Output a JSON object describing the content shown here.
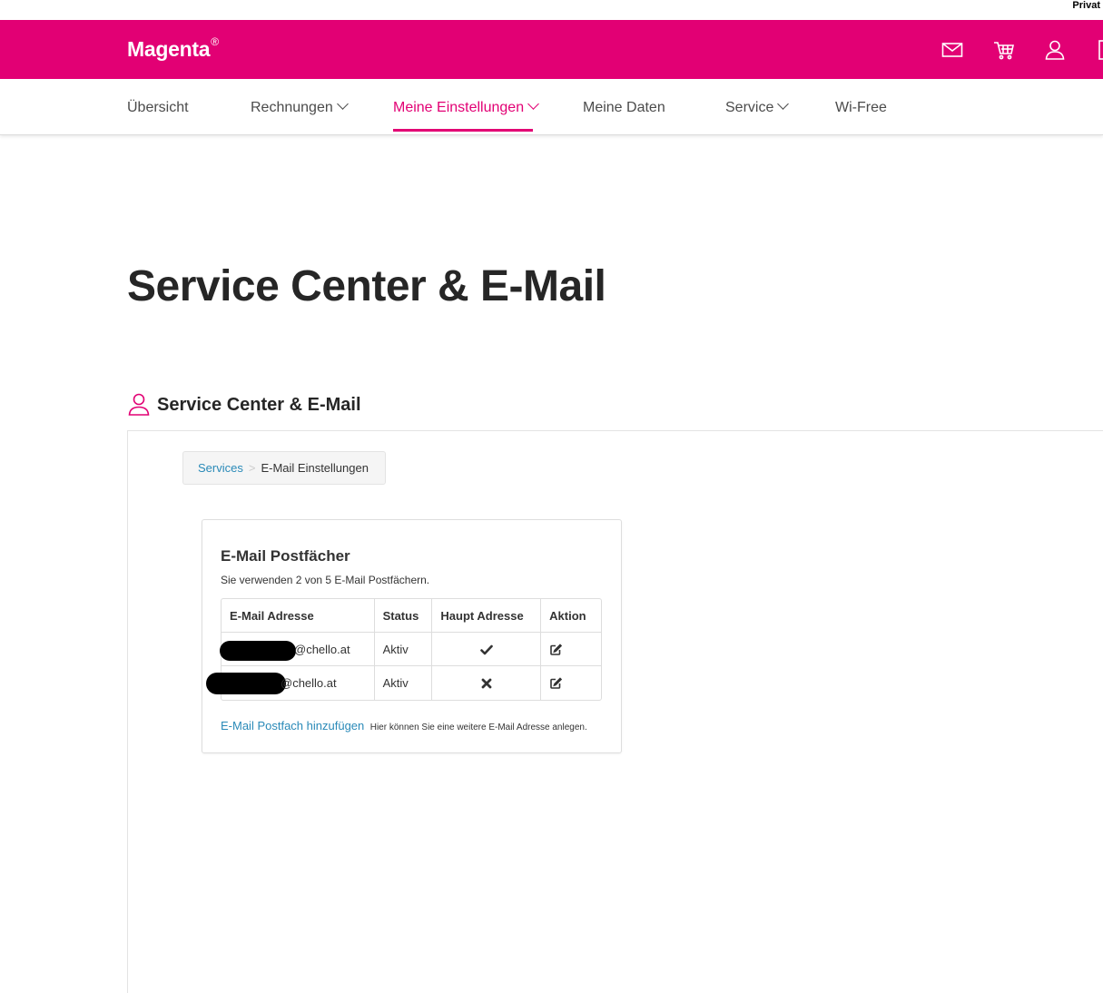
{
  "topbar": {
    "segment_label": "Privat"
  },
  "header": {
    "brand": "Magenta",
    "brand_mark": "®",
    "icons": [
      "mail-icon",
      "cart-icon",
      "user-icon",
      "menu-icon"
    ],
    "color": "#e20074"
  },
  "nav": {
    "items": [
      {
        "label": "Übersicht",
        "has_dropdown": false,
        "active": false
      },
      {
        "label": "Rechnungen",
        "has_dropdown": true,
        "active": false
      },
      {
        "label": "Meine Einstellungen",
        "has_dropdown": true,
        "active": true
      },
      {
        "label": "Meine Daten",
        "has_dropdown": false,
        "active": false
      },
      {
        "label": "Service",
        "has_dropdown": true,
        "active": false
      },
      {
        "label": "Wi-Free",
        "has_dropdown": false,
        "active": false
      }
    ]
  },
  "page": {
    "title": "Service Center & E-Mail",
    "section_title": "Service Center & E-Mail",
    "section_icon": "person-icon"
  },
  "breadcrumb": {
    "link": "Services",
    "separator": ">",
    "current": "E-Mail Einstellungen"
  },
  "mailboxes": {
    "title": "E-Mail Postfächer",
    "subtitle": "Sie verwenden 2 von 5 E-Mail Postfächern.",
    "columns": [
      "E-Mail Adresse",
      "Status",
      "Haupt Adresse",
      "Aktion"
    ],
    "rows": [
      {
        "email": "@chello.at",
        "status": "Aktiv",
        "main": "check-icon",
        "action": "edit-icon"
      },
      {
        "email": "@chello.at",
        "status": "Aktiv",
        "main": "cross-icon",
        "action": "edit-icon"
      }
    ],
    "add_link": "E-Mail Postfach hinzufügen",
    "add_hint": "Hier können Sie eine weitere E-Mail Adresse anlegen."
  },
  "colors": {
    "brand": "#e20074",
    "link": "#2a8ab8",
    "text": "#262626"
  }
}
